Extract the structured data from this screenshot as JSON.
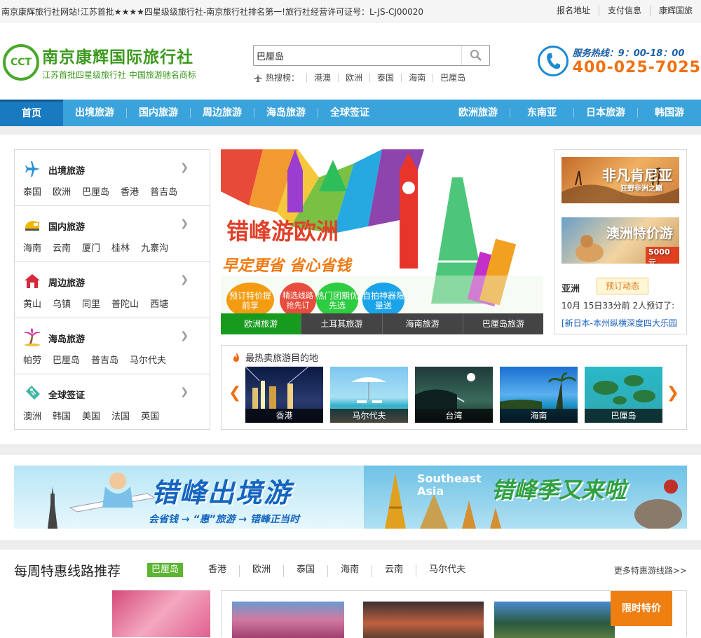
{
  "topbar": {
    "notice": "南京康辉旅行社网站!江苏首批★★★★四星级级旅行社-南京旅行社排名第一!旅行社经营许可证号：L-JS-CJ00020",
    "links": [
      "报名地址",
      "支付信息",
      "康辉国旅"
    ]
  },
  "logo": {
    "mark": "CCT",
    "title": "南京康辉国际旅行社",
    "subtitle": "江苏首批四星级旅行社  中国旅游驰名商标"
  },
  "search": {
    "value": "巴厘岛",
    "hot_label": "热搜榜：",
    "keywords": [
      "港澳",
      "欧洲",
      "泰国",
      "海南",
      "巴厘岛"
    ]
  },
  "hotline": {
    "label": "服务热线：9：00-18：00",
    "number": "400-025-7025"
  },
  "nav": {
    "items": [
      "首页",
      "出境旅游",
      "国内旅游",
      "周边旅游",
      "海岛旅游",
      "全球签证"
    ],
    "right_items": [
      "欧洲旅游",
      "东南亚",
      "日本旅游",
      "韩国游"
    ]
  },
  "categories": [
    {
      "title": "出境旅游",
      "icon": "plane-icon",
      "subs": [
        "泰国",
        "欧洲",
        "巴厘岛",
        "香港",
        "普吉岛"
      ]
    },
    {
      "title": "国内旅游",
      "icon": "train-icon",
      "subs": [
        "海南",
        "云南",
        "厦门",
        "桂林",
        "九寨沟"
      ]
    },
    {
      "title": "周边旅游",
      "icon": "house-icon",
      "subs": [
        "黄山",
        "乌镇",
        "同里",
        "普陀山",
        "西塘"
      ]
    },
    {
      "title": "海岛旅游",
      "icon": "palm-icon",
      "subs": [
        "帕劳",
        "巴厘岛",
        "普吉岛",
        "马尔代夫"
      ]
    },
    {
      "title": "全球签证",
      "icon": "visa-icon",
      "subs": [
        "澳洲",
        "韩国",
        "美国",
        "法国",
        "英国"
      ]
    }
  ],
  "banner": {
    "headline": "错峰游欧洲",
    "slogan": "早定更省  省心省钱",
    "badges": [
      "预订特价提前享",
      "精选线路抢先订",
      "热门团期优先选",
      "自拍神器限量送"
    ],
    "tabs": [
      "欧洲旅游",
      "土耳其旅游",
      "海南旅游",
      "巴厘岛旅游"
    ]
  },
  "side": {
    "ad1": "非凡肯尼亚",
    "ad1_sub": "狂野非洲之巅",
    "ad2": "澳洲特价游",
    "ad2_price": "5000元",
    "region": "亚洲",
    "booking_badge": "预订动态",
    "booking_time": "10月 15日33分前 2人预订了:",
    "booking_link": "[新日本-本州纵横深度四大乐园"
  },
  "hot_destinations": {
    "title": "最热卖旅游目的地",
    "items": [
      "香港",
      "马尔代夫",
      "台湾",
      "海南",
      "巴厘岛"
    ]
  },
  "promo": {
    "left_title": "错峰出境游",
    "left_sub": "会省钱 → “惠”旅游 → 错峰正当时",
    "right_en": "Southeast Asia",
    "right_title": "错峰季又来啦"
  },
  "weekly": {
    "title": "每周特惠线路推荐",
    "tabs": [
      "巴厘岛",
      "香港",
      "欧洲",
      "泰国",
      "海南",
      "云南",
      "马尔代夫"
    ],
    "more": "更多特惠游线路>>",
    "limited": "限时特价"
  }
}
